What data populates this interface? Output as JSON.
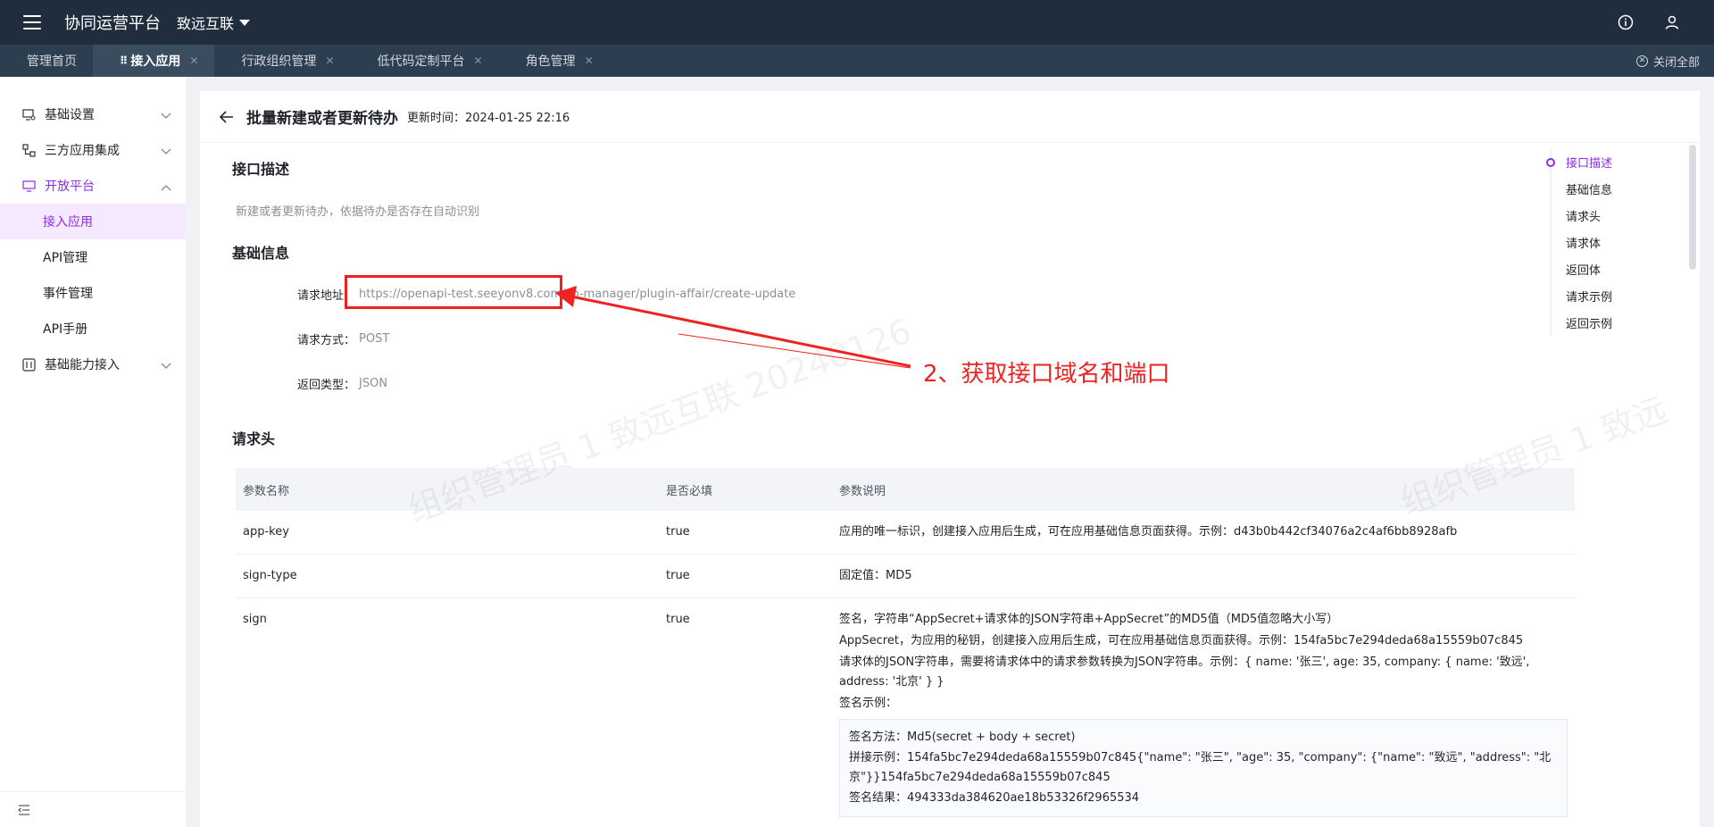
{
  "topbar": {
    "app_title": "协同运营平台",
    "org_name": "致远互联"
  },
  "tabs": [
    {
      "label": "管理首页",
      "closable": false,
      "active": false
    },
    {
      "label": "接入应用",
      "closable": true,
      "active": true
    },
    {
      "label": "行政组织管理",
      "closable": true,
      "active": false
    },
    {
      "label": "低代码定制平台",
      "closable": true,
      "active": false
    },
    {
      "label": "角色管理",
      "closable": true,
      "active": false
    }
  ],
  "close_all_label": "关闭全部",
  "sidebar": {
    "items": [
      {
        "label": "基础设置",
        "icon": "monitor-gear-icon"
      },
      {
        "label": "三方应用集成",
        "icon": "network-icon"
      },
      {
        "label": "开放平台",
        "icon": "monitor-icon",
        "open": true
      },
      {
        "label": "基础能力接入",
        "icon": "grid-icon"
      }
    ],
    "sub_items": [
      {
        "label": "接入应用",
        "active": true
      },
      {
        "label": "API管理",
        "active": false
      },
      {
        "label": "事件管理",
        "active": false
      },
      {
        "label": "API手册",
        "active": false
      }
    ]
  },
  "page": {
    "title": "批量新建或者更新待办",
    "update_time": "更新时间：2024-01-25 22:16"
  },
  "sections": {
    "desc_title": "接口描述",
    "desc_text": "新建或者更新待办，依据待办是否存在自动识别",
    "basic_title": "基础信息",
    "url_label": "请求地址：",
    "url_value": "https://openapi-test.seeyonv8.com/co-manager/plugin-affair/create-update",
    "method_label": "请求方式：",
    "method_value": "POST",
    "return_label": "返回类型：",
    "return_value": "JSON",
    "header_title": "请求头"
  },
  "table": {
    "columns": [
      "参数名称",
      "是否必填",
      "参数说明"
    ],
    "rows": [
      {
        "name": "app-key",
        "required": "true",
        "desc": "应用的唯一标识，创建接入应用后生成，可在应用基础信息页面获得。示例：d43b0b442cf34076a2c4af6bb8928afb"
      },
      {
        "name": "sign-type",
        "required": "true",
        "desc": "固定值：MD5"
      },
      {
        "name": "sign",
        "required": "true",
        "desc1": "签名，字符串“AppSecret+请求体的JSON字符串+AppSecret”的MD5值（MD5值忽略大小写）",
        "desc2": "AppSecret，为应用的秘钥，创建接入应用后生成，可在应用基础信息页面获得。示例：154fa5bc7e294deda68a15559b07c845",
        "desc3": "请求体的JSON字符串，需要将请求体中的请求参数转换为JSON字符串。示例：{ name: '张三', age: 35, company: { name: '致远', address: '北京' } }",
        "desc4": "签名示例：",
        "box_method": "签名方法：Md5(secret + body + secret)",
        "box_concat": "拼接示例：154fa5bc7e294deda68a15559b07c845{\"name\": \"张三\", \"age\": 35, \"company\": {\"name\": \"致远\", \"address\": \"北京\"}}154fa5bc7e294deda68a15559b07c845",
        "box_result": "签名结果：494333da384620ae18b53326f2965534"
      }
    ]
  },
  "anchors": [
    "接口描述",
    "基础信息",
    "请求头",
    "请求体",
    "返回体",
    "请求示例",
    "返回示例"
  ],
  "watermark": {
    "text1": "组织管理员 1 致远互联 20240126",
    "text2": "组织管理员 1 致远"
  },
  "annotation": {
    "text": "2、获取接口域名和端口",
    "color": "#ee2222"
  },
  "colors": {
    "topbar_bg": "#1f2d3d",
    "accent": "#8c2ce4"
  }
}
